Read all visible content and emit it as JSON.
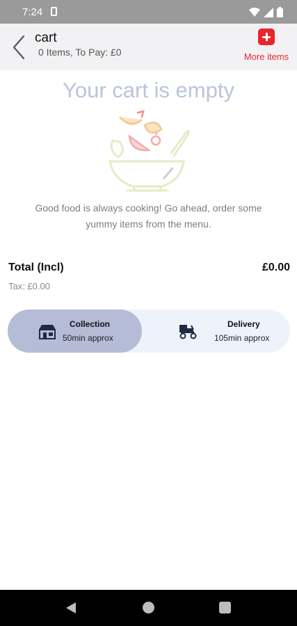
{
  "status_bar": {
    "time": "7:24"
  },
  "header": {
    "title": "cart",
    "subtitle": "0 Items, To Pay: £0",
    "more_items_label": "More items"
  },
  "empty_state": {
    "title": "Your cart is empty",
    "message": "Good food is always cooking! Go ahead, order some yummy items from the menu."
  },
  "totals": {
    "total_label": "Total (Incl)",
    "total_value": "£0.00",
    "tax": "Tax: £0.00"
  },
  "order_type": {
    "selected": "collection",
    "options": [
      {
        "id": "collection",
        "title": "Collection",
        "subtitle": "50min approx",
        "icon": "collection-store-icon"
      },
      {
        "id": "delivery",
        "title": "Delivery",
        "subtitle": "105min approx",
        "icon": "delivery-scooter-icon"
      }
    ]
  },
  "colors": {
    "accent_red": "#e8262c",
    "empty_title": "#bcc3dc",
    "selected_option": "#b4bcd6",
    "toggle_bg": "#eef3fb"
  }
}
